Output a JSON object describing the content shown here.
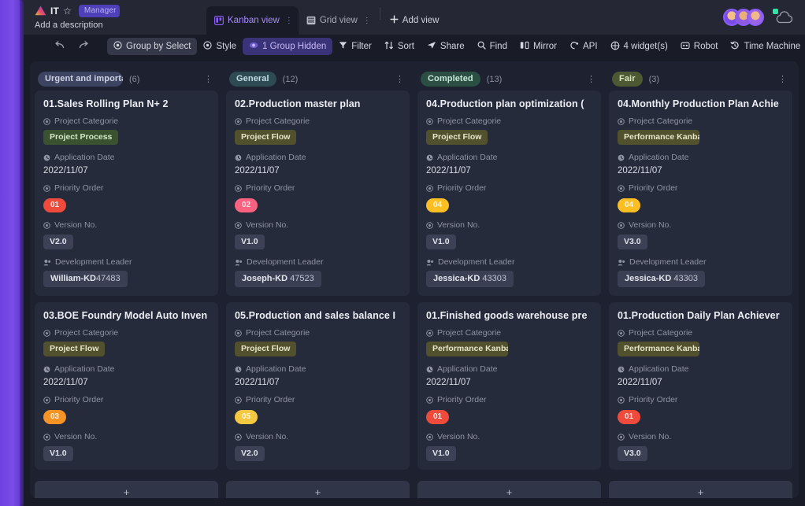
{
  "header": {
    "base_name": "IT",
    "star_icon": "star-outline-icon",
    "manage_badge": "Manager",
    "description": "Add a description",
    "logo_icon": "vika-triangle-logo",
    "cloud_icon": "cloud-sync-icon",
    "avatars": [
      "avatar-1",
      "avatar-2",
      "avatar-3"
    ]
  },
  "tabs": [
    {
      "label": "Kanban view",
      "icon": "kanban-view-icon",
      "active": true
    },
    {
      "label": "Grid view",
      "icon": "grid-view-icon",
      "active": false
    }
  ],
  "add_view": {
    "label": "Add view",
    "icon": "plus-icon"
  },
  "toolbar": {
    "undo_icon": "undo-arrow-icon",
    "redo_icon": "redo-arrow-icon",
    "buttons": [
      {
        "label": "Group by Select",
        "icon": "gear-icon",
        "style": "filled"
      },
      {
        "label": "Style",
        "icon": "gear-icon",
        "style": "plain"
      },
      {
        "label": "1 Group Hidden",
        "icon": "eye-icon",
        "style": "group-hidden"
      },
      {
        "label": "Filter",
        "icon": "filter-icon",
        "style": "plain"
      },
      {
        "label": "Sort",
        "icon": "sort-icon",
        "style": "plain"
      },
      {
        "label": "Share",
        "icon": "share-icon",
        "style": "plain"
      }
    ],
    "right_buttons": [
      {
        "label": "Find",
        "icon": "search-icon"
      },
      {
        "label": "Mirror",
        "icon": "mirror-icon"
      },
      {
        "label": "API",
        "icon": "api-icon"
      },
      {
        "label": "4 widget(s)",
        "icon": "widget-icon"
      },
      {
        "label": "Robot",
        "icon": "robot-icon"
      },
      {
        "label": "Time Machine",
        "icon": "time-machine-icon"
      }
    ]
  },
  "field_labels": {
    "category": "Project Categorie",
    "date": "Application Date",
    "priority": "Priority Order",
    "version": "Version No.",
    "leader": "Development Leader"
  },
  "field_icons": {
    "category": "single-select-icon",
    "date": "clock-icon",
    "priority": "single-select-icon",
    "version": "single-select-icon",
    "leader": "member-icon"
  },
  "add_card_label": "+",
  "colors": {
    "accent_purple": "#8b5cf6",
    "tag_urgent_bg": "#3d4461",
    "tag_general_bg": "#2e4a52",
    "tag_completed_bg": "#2b4f43",
    "tag_fair_bg": "#4c5a33",
    "chip_project_process": "#3b5230",
    "chip_project_flow": "#51512e",
    "chip_performance": "#51512e",
    "pill_red": "#ef4b3c",
    "pill_pink": "#f8617f",
    "pill_yellow": "#f5c842",
    "pill_orange": "#f59425",
    "pill_amber": "#fbbf24"
  },
  "columns": [
    {
      "tag": "Urgent and important",
      "tag_bg": "#3d4461",
      "tag_color": "#cfd3e4",
      "count": "(6)",
      "menu_icon": "more-vertical-icon",
      "cards": [
        {
          "title": "01.Sales Rolling Plan N+ 2",
          "category": "Project Process",
          "category_bg": "#3b5230",
          "category_color": "#d5e8c5",
          "date": "2022/11/07",
          "priority": "01",
          "priority_bg": "#ef4b3c",
          "priority_color": "#ffe3df",
          "version": "V2.0",
          "leader_name": "William-KD",
          "leader_id": "47483",
          "clipped": false
        },
        {
          "title": "03.BOE Foundry Model Auto Inven",
          "category": "Project Flow",
          "category_bg": "#51512e",
          "category_color": "#e8e6c8",
          "date": "2022/11/07",
          "priority": "03",
          "priority_bg": "#f59425",
          "priority_color": "#fff0dc",
          "version": "V1.0",
          "leader_name": "",
          "leader_id": "",
          "clipped": true
        }
      ]
    },
    {
      "tag": "General",
      "tag_bg": "#2e4a52",
      "tag_color": "#c2dde4",
      "count": "(12)",
      "menu_icon": "more-vertical-icon",
      "cards": [
        {
          "title": "02.Production master plan",
          "category": "Project Flow",
          "category_bg": "#51512e",
          "category_color": "#e8e6c8",
          "date": "2022/11/07",
          "priority": "02",
          "priority_bg": "#f8617f",
          "priority_color": "#ffdde5",
          "version": "V1.0",
          "leader_name": "Joseph-KD",
          "leader_id": "47523",
          "clipped": false
        },
        {
          "title": "05.Production and sales balance I",
          "category": "Project Flow",
          "category_bg": "#51512e",
          "category_color": "#e8e6c8",
          "date": "2022/11/07",
          "priority": "05",
          "priority_bg": "#f5c842",
          "priority_color": "#fff6d8",
          "version": "V2.0",
          "leader_name": "",
          "leader_id": "",
          "clipped": true
        }
      ]
    },
    {
      "tag": "Completed",
      "tag_bg": "#2b4f43",
      "tag_color": "#c6e7d8",
      "count": "(13)",
      "menu_icon": "more-vertical-icon",
      "cards": [
        {
          "title": "04.Production plan optimization (",
          "category": "Project Flow",
          "category_bg": "#51512e",
          "category_color": "#e8e6c8",
          "date": "2022/11/07",
          "priority": "04",
          "priority_bg": "#fbbf24",
          "priority_color": "#fff6dc",
          "version": "V1.0",
          "leader_name": "Jessica-KD",
          "leader_id": "43303",
          "clipped": false
        },
        {
          "title": "01.Finished goods warehouse pre",
          "category": "Performance Kanban",
          "category_bg": "#51512e",
          "category_color": "#e8e6c8",
          "date": "2022/11/07",
          "priority": "01",
          "priority_bg": "#ef4b3c",
          "priority_color": "#ffe3df",
          "version": "V1.0",
          "leader_name": "",
          "leader_id": "",
          "clipped": true
        }
      ]
    },
    {
      "tag": "Fair",
      "tag_bg": "#4c5a33",
      "tag_color": "#dbe6bc",
      "count": "(3)",
      "menu_icon": "more-vertical-icon",
      "cards": [
        {
          "title": "04.Monthly Production Plan Achie",
          "category": "Performance Kanban",
          "category_bg": "#51512e",
          "category_color": "#e8e6c8",
          "date": "2022/11/07",
          "priority": "04",
          "priority_bg": "#fbbf24",
          "priority_color": "#fff6dc",
          "version": "V3.0",
          "leader_name": "Jessica-KD",
          "leader_id": "43303",
          "clipped": false
        },
        {
          "title": "01.Production Daily Plan Achiever",
          "category": "Performance Kanban",
          "category_bg": "#51512e",
          "category_color": "#e8e6c8",
          "date": "2022/11/07",
          "priority": "01",
          "priority_bg": "#ef4b3c",
          "priority_color": "#ffe3df",
          "version": "V3.0",
          "leader_name": "",
          "leader_id": "",
          "clipped": true
        }
      ]
    }
  ]
}
